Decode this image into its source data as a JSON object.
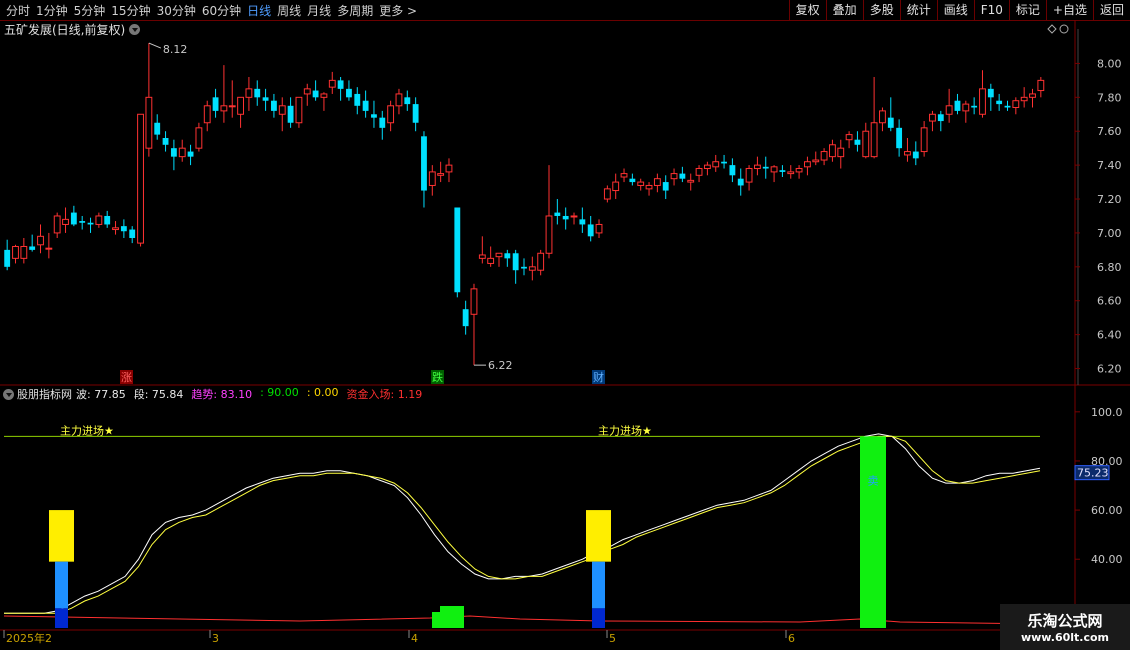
{
  "toolbar": {
    "periods": [
      "分时",
      "1分钟",
      "5分钟",
      "15分钟",
      "30分钟",
      "60分钟",
      "日线",
      "周线",
      "月线",
      "多周期",
      "更多 >"
    ],
    "active_period": "日线",
    "actions": [
      "复权",
      "叠加",
      "多股",
      "统计",
      "画线",
      "F10",
      "标记",
      "+自选",
      "返回"
    ]
  },
  "main": {
    "title": "五矿发展(日线,前复权)",
    "high_label": "8.12",
    "low_label": "6.22",
    "price_axis": [
      "8.00",
      "7.80",
      "7.60",
      "7.40",
      "7.20",
      "7.00",
      "6.80",
      "6.60",
      "6.40",
      "6.20"
    ],
    "badges": [
      "涨",
      "跌",
      "财"
    ]
  },
  "indicator": {
    "name": "股朋指标网",
    "values": [
      {
        "text": "波: 77.85",
        "color": "#e8e8e8"
      },
      {
        "text": "段: 75.84",
        "color": "#e8e8e8"
      },
      {
        "text": "趋势: 83.10",
        "color": "#ff40ff"
      },
      {
        "text": ": 90.00",
        "color": "#00e000"
      },
      {
        "text": ": 0.00",
        "color": "#ffd800"
      },
      {
        "text": "资金入场: 1.19",
        "color": "#ff3030"
      }
    ],
    "axis": [
      "100.0",
      "80.00",
      "60.00",
      "40.00",
      "20.00"
    ],
    "current_value": "75.23",
    "signal_text": "主力进场★",
    "bar_label": "卖"
  },
  "date_axis": [
    "2025年2",
    "3",
    "4",
    "5",
    "6"
  ],
  "watermark": {
    "line1": "乐淘公式网",
    "line2": "www.60lt.com"
  },
  "colors": {
    "up": "#ff3232",
    "down": "#00e0ff",
    "grid": "#7a0000",
    "line_white": "#ffffff",
    "line_yellow": "#ffff40",
    "signal_line": "#8fd000"
  },
  "chart_data": {
    "type": "candlestick",
    "ohlc": [
      [
        6.9,
        6.96,
        6.78,
        6.8
      ],
      [
        6.85,
        6.93,
        6.82,
        6.92
      ],
      [
        6.85,
        6.97,
        6.82,
        6.92
      ],
      [
        6.92,
        6.99,
        6.89,
        6.9
      ],
      [
        6.93,
        7.05,
        6.88,
        6.98
      ],
      [
        6.91,
        7.0,
        6.85,
        6.91
      ],
      [
        7.0,
        7.12,
        6.97,
        7.1
      ],
      [
        7.05,
        7.15,
        7.0,
        7.08
      ],
      [
        7.12,
        7.16,
        7.04,
        7.05
      ],
      [
        7.07,
        7.1,
        7.02,
        7.06
      ],
      [
        7.06,
        7.09,
        7.0,
        7.05
      ],
      [
        7.05,
        7.12,
        7.03,
        7.1
      ],
      [
        7.1,
        7.13,
        7.03,
        7.05
      ],
      [
        7.02,
        7.07,
        6.99,
        7.03
      ],
      [
        7.04,
        7.08,
        6.97,
        7.01
      ],
      [
        7.02,
        7.04,
        6.94,
        6.97
      ],
      [
        6.94,
        7.7,
        6.92,
        7.7
      ],
      [
        7.5,
        8.12,
        7.45,
        7.8
      ],
      [
        7.65,
        7.7,
        7.55,
        7.58
      ],
      [
        7.56,
        7.6,
        7.48,
        7.52
      ],
      [
        7.5,
        7.55,
        7.37,
        7.45
      ],
      [
        7.45,
        7.55,
        7.42,
        7.5
      ],
      [
        7.48,
        7.52,
        7.4,
        7.45
      ],
      [
        7.5,
        7.65,
        7.48,
        7.62
      ],
      [
        7.65,
        7.78,
        7.6,
        7.75
      ],
      [
        7.8,
        7.85,
        7.68,
        7.72
      ],
      [
        7.72,
        7.99,
        7.65,
        7.75
      ],
      [
        7.75,
        7.9,
        7.68,
        7.75
      ],
      [
        7.7,
        7.8,
        7.62,
        7.8
      ],
      [
        7.8,
        7.92,
        7.72,
        7.85
      ],
      [
        7.85,
        7.9,
        7.75,
        7.8
      ],
      [
        7.8,
        7.85,
        7.72,
        7.78
      ],
      [
        7.78,
        7.82,
        7.68,
        7.72
      ],
      [
        7.7,
        7.8,
        7.6,
        7.75
      ],
      [
        7.75,
        7.8,
        7.62,
        7.65
      ],
      [
        7.65,
        7.8,
        7.62,
        7.8
      ],
      [
        7.82,
        7.88,
        7.75,
        7.85
      ],
      [
        7.84,
        7.9,
        7.78,
        7.8
      ],
      [
        7.8,
        7.83,
        7.72,
        7.82
      ],
      [
        7.86,
        7.95,
        7.82,
        7.9
      ],
      [
        7.9,
        7.92,
        7.78,
        7.85
      ],
      [
        7.85,
        7.9,
        7.78,
        7.8
      ],
      [
        7.82,
        7.86,
        7.7,
        7.75
      ],
      [
        7.78,
        7.84,
        7.68,
        7.72
      ],
      [
        7.7,
        7.78,
        7.62,
        7.68
      ],
      [
        7.68,
        7.72,
        7.55,
        7.62
      ],
      [
        7.65,
        7.78,
        7.6,
        7.75
      ],
      [
        7.75,
        7.85,
        7.7,
        7.82
      ],
      [
        7.8,
        7.84,
        7.72,
        7.76
      ],
      [
        7.76,
        7.8,
        7.6,
        7.65
      ],
      [
        7.57,
        7.6,
        7.15,
        7.25
      ],
      [
        7.28,
        7.4,
        7.22,
        7.36
      ],
      [
        7.34,
        7.42,
        7.3,
        7.35
      ],
      [
        7.36,
        7.44,
        7.3,
        7.4
      ],
      [
        7.15,
        7.15,
        6.62,
        6.65
      ],
      [
        6.55,
        6.6,
        6.4,
        6.45
      ],
      [
        6.52,
        6.7,
        6.22,
        6.67
      ],
      [
        6.85,
        6.98,
        6.82,
        6.87
      ],
      [
        6.82,
        6.92,
        6.8,
        6.85
      ],
      [
        6.86,
        6.88,
        6.8,
        6.88
      ],
      [
        6.88,
        6.9,
        6.8,
        6.85
      ],
      [
        6.88,
        6.9,
        6.7,
        6.78
      ],
      [
        6.8,
        6.85,
        6.75,
        6.79
      ],
      [
        6.78,
        6.86,
        6.72,
        6.8
      ],
      [
        6.78,
        6.9,
        6.75,
        6.88
      ],
      [
        6.88,
        7.4,
        6.85,
        7.1
      ],
      [
        7.12,
        7.2,
        7.05,
        7.1
      ],
      [
        7.1,
        7.15,
        7.02,
        7.08
      ],
      [
        7.1,
        7.12,
        7.05,
        7.1
      ],
      [
        7.08,
        7.15,
        7.0,
        7.05
      ],
      [
        7.05,
        7.1,
        6.95,
        6.98
      ],
      [
        7.0,
        7.08,
        6.97,
        7.05
      ],
      [
        7.2,
        7.28,
        7.18,
        7.26
      ],
      [
        7.25,
        7.35,
        7.2,
        7.3
      ],
      [
        7.33,
        7.38,
        7.3,
        7.35
      ],
      [
        7.32,
        7.35,
        7.28,
        7.3
      ],
      [
        7.28,
        7.32,
        7.25,
        7.3
      ],
      [
        7.26,
        7.3,
        7.22,
        7.28
      ],
      [
        7.28,
        7.35,
        7.24,
        7.32
      ],
      [
        7.3,
        7.34,
        7.2,
        7.25
      ],
      [
        7.32,
        7.38,
        7.28,
        7.35
      ],
      [
        7.35,
        7.39,
        7.3,
        7.32
      ],
      [
        7.3,
        7.35,
        7.25,
        7.31
      ],
      [
        7.34,
        7.4,
        7.3,
        7.38
      ],
      [
        7.38,
        7.42,
        7.34,
        7.4
      ],
      [
        7.39,
        7.46,
        7.36,
        7.42
      ],
      [
        7.42,
        7.46,
        7.38,
        7.41
      ],
      [
        7.4,
        7.44,
        7.3,
        7.34
      ],
      [
        7.32,
        7.38,
        7.22,
        7.28
      ],
      [
        7.3,
        7.4,
        7.25,
        7.38
      ],
      [
        7.38,
        7.45,
        7.34,
        7.4
      ],
      [
        7.39,
        7.45,
        7.32,
        7.38
      ],
      [
        7.36,
        7.4,
        7.3,
        7.39
      ],
      [
        7.37,
        7.4,
        7.33,
        7.36
      ],
      [
        7.35,
        7.4,
        7.32,
        7.36
      ],
      [
        7.36,
        7.4,
        7.32,
        7.38
      ],
      [
        7.39,
        7.45,
        7.34,
        7.42
      ],
      [
        7.42,
        7.48,
        7.4,
        7.43
      ],
      [
        7.43,
        7.5,
        7.4,
        7.48
      ],
      [
        7.45,
        7.55,
        7.42,
        7.52
      ],
      [
        7.45,
        7.55,
        7.38,
        7.5
      ],
      [
        7.55,
        7.6,
        7.5,
        7.58
      ],
      [
        7.55,
        7.6,
        7.48,
        7.52
      ],
      [
        7.45,
        7.65,
        7.44,
        7.6
      ],
      [
        7.45,
        7.92,
        7.44,
        7.65
      ],
      [
        7.65,
        7.74,
        7.6,
        7.72
      ],
      [
        7.68,
        7.8,
        7.6,
        7.62
      ],
      [
        7.62,
        7.67,
        7.45,
        7.5
      ],
      [
        7.46,
        7.56,
        7.42,
        7.48
      ],
      [
        7.48,
        7.54,
        7.4,
        7.44
      ],
      [
        7.48,
        7.66,
        7.45,
        7.62
      ],
      [
        7.66,
        7.72,
        7.6,
        7.7
      ],
      [
        7.7,
        7.72,
        7.6,
        7.66
      ],
      [
        7.7,
        7.85,
        7.65,
        7.75
      ],
      [
        7.78,
        7.82,
        7.7,
        7.72
      ],
      [
        7.72,
        7.78,
        7.65,
        7.76
      ],
      [
        7.75,
        7.8,
        7.7,
        7.74
      ],
      [
        7.7,
        7.96,
        7.68,
        7.85
      ],
      [
        7.85,
        7.88,
        7.72,
        7.8
      ],
      [
        7.78,
        7.82,
        7.72,
        7.76
      ],
      [
        7.75,
        7.78,
        7.72,
        7.74
      ],
      [
        7.74,
        7.8,
        7.7,
        7.78
      ],
      [
        7.78,
        7.86,
        7.74,
        7.8
      ],
      [
        7.8,
        7.85,
        7.74,
        7.82
      ],
      [
        7.84,
        7.92,
        7.8,
        7.9
      ]
    ],
    "ylim": [
      6.15,
      8.15
    ],
    "indicator_lines": {
      "ylim": [
        12,
        104
      ],
      "white": [
        18,
        18,
        18,
        18,
        19,
        22,
        25,
        27,
        30,
        33,
        40,
        50,
        55,
        57,
        58,
        60,
        63,
        66,
        69,
        71,
        73,
        74,
        75,
        75,
        76,
        76,
        75,
        74,
        72,
        70,
        65,
        58,
        50,
        43,
        38,
        34,
        32,
        32,
        33,
        33,
        34,
        36,
        38,
        40,
        43,
        45,
        48,
        50,
        52,
        54,
        56,
        58,
        60,
        62,
        63,
        64,
        66,
        68,
        72,
        76,
        80,
        83,
        86,
        88,
        90,
        91,
        90,
        85,
        78,
        73,
        71,
        71,
        72,
        74,
        75,
        75,
        76,
        77
      ],
      "yellow": [
        18,
        18,
        18,
        18,
        18,
        20,
        23,
        25,
        28,
        31,
        37,
        46,
        52,
        55,
        57,
        58,
        61,
        64,
        67,
        70,
        72,
        73,
        74,
        74,
        75,
        75,
        75,
        74,
        73,
        71,
        67,
        61,
        54,
        47,
        41,
        36,
        33,
        32,
        32,
        33,
        33,
        35,
        37,
        39,
        41,
        44,
        46,
        49,
        51,
        53,
        55,
        57,
        59,
        61,
        62,
        63,
        65,
        67,
        70,
        74,
        78,
        81,
        84,
        86,
        88,
        90,
        90,
        88,
        82,
        76,
        72,
        71,
        71,
        72,
        73,
        74,
        75,
        76
      ]
    }
  }
}
